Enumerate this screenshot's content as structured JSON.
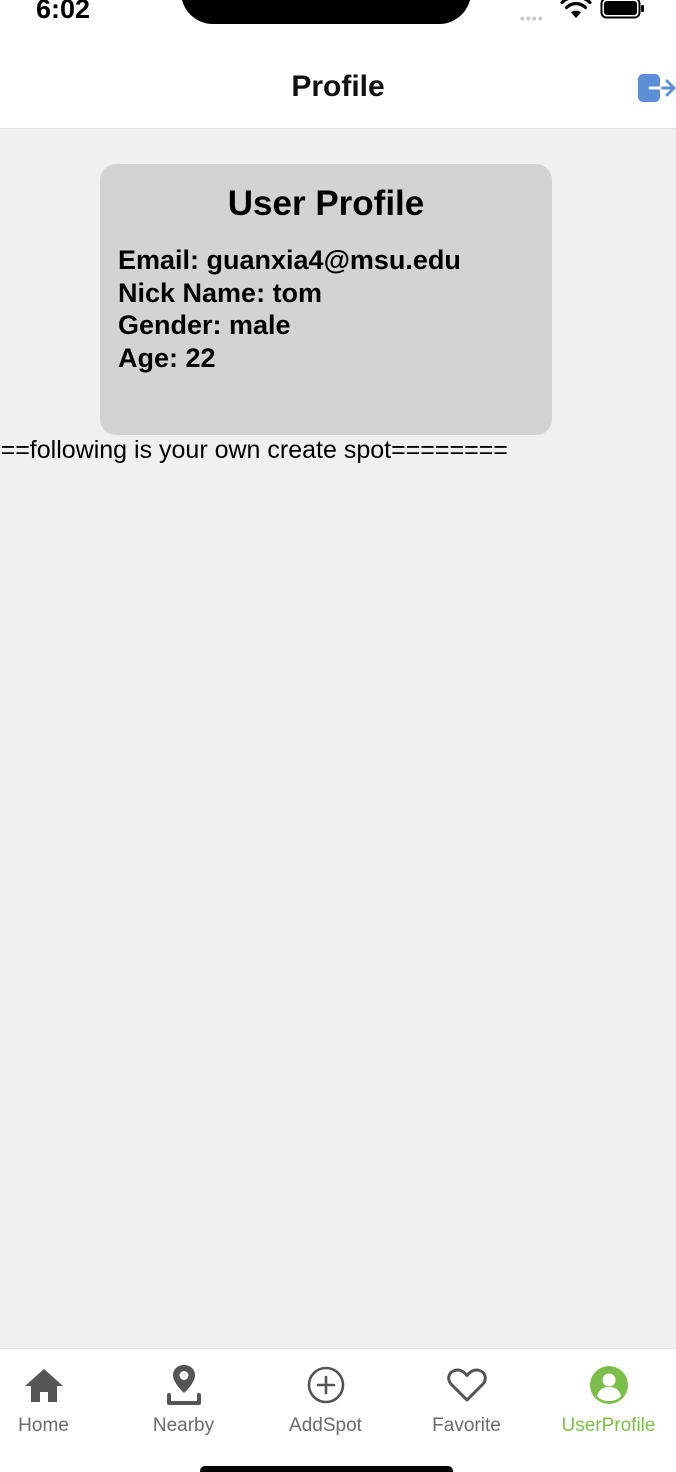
{
  "status_bar": {
    "time": "6:02",
    "signal_icon": "cellular-signal-icon",
    "wifi_icon": "wifi-icon",
    "battery_icon": "battery-icon"
  },
  "header": {
    "title": "Profile",
    "logout_icon": "logout-icon"
  },
  "profile_card": {
    "title": "User Profile",
    "lines": [
      "Email: guanxia4@msu.edu",
      "Nick Name: tom",
      "Gender: male",
      "Age: 22"
    ]
  },
  "divider_text": "===following is your own create spot========",
  "tabs": [
    {
      "label": "Home",
      "icon": "home-icon"
    },
    {
      "label": "Nearby",
      "icon": "location-pin-icon"
    },
    {
      "label": "AddSpot",
      "icon": "plus-circle-icon"
    },
    {
      "label": "Favorite",
      "icon": "heart-icon"
    },
    {
      "label": "UserProfile",
      "icon": "user-circle-icon",
      "active": true
    }
  ],
  "colors": {
    "accent": "#7bbf4a",
    "logout": "#5b8fd6",
    "card_background": "#d3d3d3",
    "page_background": "#f0f0f0"
  }
}
